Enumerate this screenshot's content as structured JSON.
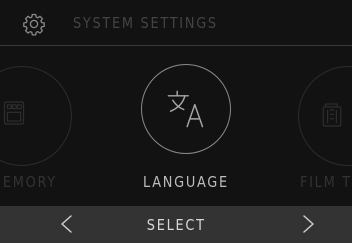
{
  "header": {
    "title": "SYSTEM SETTINGS",
    "icon": "gear-icon"
  },
  "carousel": {
    "items": [
      {
        "label": "MEMORY",
        "icon": "memory-card-icon",
        "state": "inactive"
      },
      {
        "label": "LANGUAGE",
        "icon": "language-translate-icon",
        "state": "selected"
      },
      {
        "label": "FILM T",
        "icon": "film-icon",
        "state": "inactive"
      }
    ]
  },
  "footer": {
    "prev_label": "<",
    "select_label": "SELECT",
    "next_label": ">"
  },
  "colors": {
    "background": "#121212",
    "footer_background": "#333333",
    "active_text": "#bdbdbd",
    "inactive_text": "#333333"
  }
}
